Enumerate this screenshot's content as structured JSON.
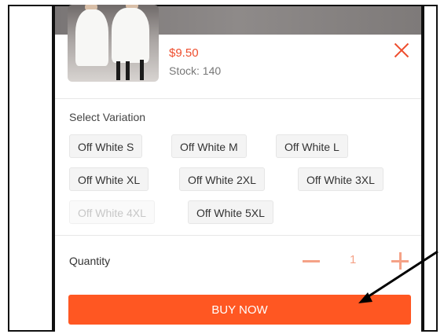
{
  "product": {
    "price": "$9.50",
    "stock": "Stock: 140"
  },
  "variation": {
    "label": "Select Variation",
    "options": [
      {
        "label": "Off White S",
        "disabled": false
      },
      {
        "label": "Off White M",
        "disabled": false
      },
      {
        "label": "Off White L",
        "disabled": false
      },
      {
        "label": "Off White XL",
        "disabled": false
      },
      {
        "label": "Off White 2XL",
        "disabled": false
      },
      {
        "label": "Off White 3XL",
        "disabled": false
      },
      {
        "label": "Off White 4XL",
        "disabled": true
      },
      {
        "label": "Off White 5XL",
        "disabled": false
      }
    ]
  },
  "quantity": {
    "label": "Quantity",
    "value": "1"
  },
  "buy_button": "BUY NOW",
  "colors": {
    "accent": "#ee4d2d",
    "button": "#ff5722",
    "stepper": "#f5a287"
  },
  "icons": [
    "close-icon",
    "minus-icon",
    "plus-icon",
    "arrow-annotation"
  ]
}
